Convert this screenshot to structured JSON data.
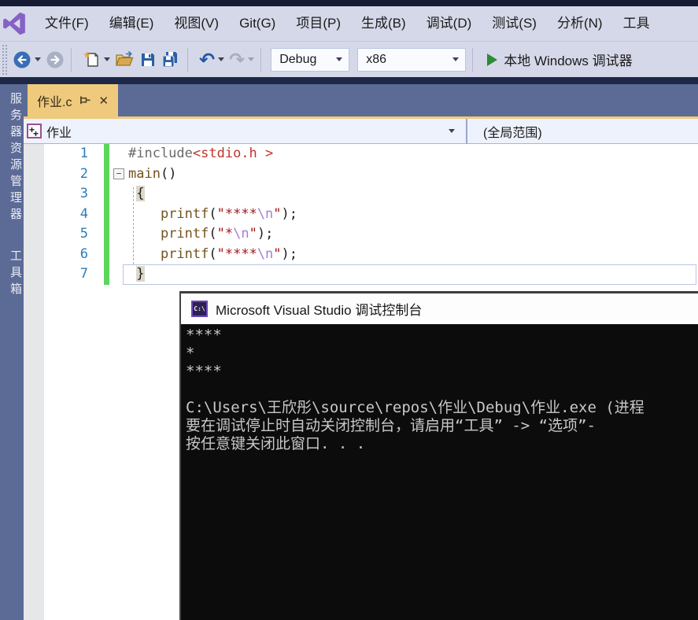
{
  "colors": {
    "accent_tab": "#efca7c",
    "frame_slate": "#5c6a96",
    "band_navy": "#1e2747",
    "menubar_bg": "#d5d8e8",
    "logo_purple": "#8661c5",
    "change_bar_green": "#5cd65c",
    "line_number_blue": "#2b7cb8",
    "string_red": "#a31515",
    "escape_purple": "#a57fd4",
    "function_brown": "#74531f",
    "console_bg": "#0c0c0c",
    "console_text": "#c8c8c8",
    "run_green": "#2e8b37"
  },
  "menu": {
    "items": [
      "文件(F)",
      "编辑(E)",
      "视图(V)",
      "Git(G)",
      "项目(P)",
      "生成(B)",
      "调试(D)",
      "测试(S)",
      "分析(N)",
      "工具"
    ]
  },
  "toolbar": {
    "debug_value": "Debug",
    "platform_value": "x86",
    "run_label": "本地 Windows 调试器"
  },
  "tab": {
    "title": "作业.c"
  },
  "navbar": {
    "left_value": "作业",
    "right_value": "(全局范围)"
  },
  "sidebar": {
    "tabs": [
      "服务器资源管理器",
      "工具箱"
    ]
  },
  "editor": {
    "lines": [
      {
        "num": 1,
        "tokens": [
          {
            "t": "#include",
            "c": "pp"
          },
          {
            "t": "<stdio.h >",
            "c": "inc"
          }
        ]
      },
      {
        "num": 2,
        "fold": true,
        "tokens": [
          {
            "t": "main",
            "c": "fn"
          },
          {
            "t": "()",
            "c": "pl"
          }
        ]
      },
      {
        "num": 3,
        "tokens": [
          {
            "t": " ",
            "c": "pl"
          },
          {
            "t": "{",
            "c": "brace"
          }
        ]
      },
      {
        "num": 4,
        "tokens": [
          {
            "t": "    ",
            "c": "pl"
          },
          {
            "t": "printf",
            "c": "fn"
          },
          {
            "t": "(",
            "c": "pl"
          },
          {
            "t": "\"****",
            "c": "str"
          },
          {
            "t": "\\n",
            "c": "esc"
          },
          {
            "t": "\"",
            "c": "str"
          },
          {
            "t": ");",
            "c": "pl"
          }
        ]
      },
      {
        "num": 5,
        "tokens": [
          {
            "t": "    ",
            "c": "pl"
          },
          {
            "t": "printf",
            "c": "fn"
          },
          {
            "t": "(",
            "c": "pl"
          },
          {
            "t": "\"*",
            "c": "str"
          },
          {
            "t": "\\n",
            "c": "esc"
          },
          {
            "t": "\"",
            "c": "str"
          },
          {
            "t": ");",
            "c": "pl"
          }
        ]
      },
      {
        "num": 6,
        "tokens": [
          {
            "t": "    ",
            "c": "pl"
          },
          {
            "t": "printf",
            "c": "fn"
          },
          {
            "t": "(",
            "c": "pl"
          },
          {
            "t": "\"****",
            "c": "str"
          },
          {
            "t": "\\n",
            "c": "esc"
          },
          {
            "t": "\"",
            "c": "str"
          },
          {
            "t": ");",
            "c": "pl"
          }
        ]
      },
      {
        "num": 7,
        "current": true,
        "tokens": [
          {
            "t": " ",
            "c": "pl"
          },
          {
            "t": "}",
            "c": "brace"
          }
        ]
      }
    ]
  },
  "console": {
    "title": "Microsoft Visual Studio 调试控制台",
    "icon_label": "C:\\",
    "lines": [
      "****",
      "*",
      "****",
      "",
      "C:\\Users\\王欣彤\\source\\repos\\作业\\Debug\\作业.exe (进程",
      "要在调试停止时自动关闭控制台，请启用“工具” -> “选项”-",
      "按任意键关闭此窗口. . ."
    ]
  }
}
